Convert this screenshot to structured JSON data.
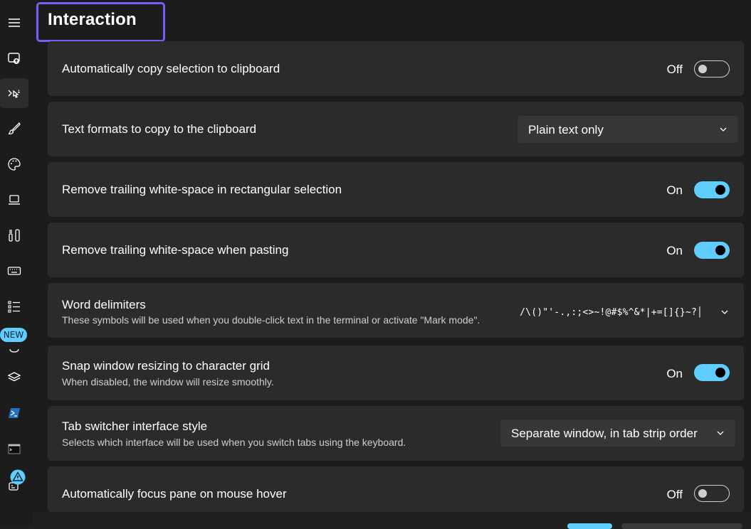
{
  "page": {
    "title": "Interaction"
  },
  "sidebar": {
    "items": [
      {
        "icon": "hamburger-menu-icon"
      },
      {
        "icon": "startup-icon"
      },
      {
        "icon": "interaction-icon",
        "selected": true
      },
      {
        "icon": "brush-icon"
      },
      {
        "icon": "palette-icon"
      },
      {
        "icon": "laptop-icon"
      },
      {
        "icon": "tools-icon"
      },
      {
        "icon": "keyboard-icon"
      },
      {
        "icon": "list-icon"
      },
      {
        "icon": "new-feature-icon"
      },
      {
        "icon": "layers-icon"
      },
      {
        "icon": "powershell-icon"
      },
      {
        "icon": "terminal-icon"
      },
      {
        "icon": "cmd-icon"
      }
    ],
    "new_badge": "NEW"
  },
  "settings": [
    {
      "label": "Automatically copy selection to clipboard",
      "state": "Off"
    },
    {
      "label": "Text formats to copy to the clipboard",
      "value": "Plain text only"
    },
    {
      "label": "Remove trailing white-space in rectangular selection",
      "state": "On"
    },
    {
      "label": "Remove trailing white-space when pasting",
      "state": "On"
    },
    {
      "label": "Word delimiters",
      "description": "These symbols will be used when you double-click text in the terminal or activate \"Mark mode\".",
      "value": "/\\()\"'-.,:;<>~!@#$%^&*|+=[]{}~?│"
    },
    {
      "label": "Snap window resizing to character grid",
      "description": "When disabled, the window will resize smoothly.",
      "state": "On"
    },
    {
      "label": "Tab switcher interface style",
      "description": "Selects which interface will be used when you switch tabs using the keyboard.",
      "value": "Separate window, in tab strip order"
    },
    {
      "label": "Automatically focus pane on mouse hover",
      "state": "Off"
    }
  ],
  "colors": {
    "accent": "#60cdff",
    "highlight_border": "#7b5cf5",
    "card": "#2b2b2b"
  }
}
